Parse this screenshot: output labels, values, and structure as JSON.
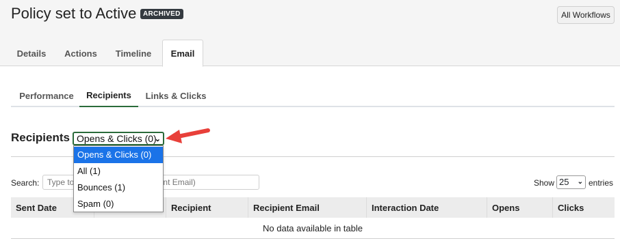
{
  "header": {
    "title": "Policy set to Active",
    "badge": "ARCHIVED",
    "all_workflows_label": "All Workflows"
  },
  "main_tabs": [
    {
      "label": "Details",
      "active": false
    },
    {
      "label": "Actions",
      "active": false
    },
    {
      "label": "Timeline",
      "active": false
    },
    {
      "label": "Email",
      "active": true
    }
  ],
  "sub_tabs": [
    {
      "label": "Performance",
      "active": false
    },
    {
      "label": "Recipients",
      "active": true
    },
    {
      "label": "Links & Clicks",
      "active": false
    }
  ],
  "recipients": {
    "heading": "Recipients",
    "filter_selected": "Opens & Clicks (0)",
    "filter_options": [
      "Opens & Clicks (0)",
      "All (1)",
      "Bounces (1)",
      "Spam (0)"
    ]
  },
  "table_controls": {
    "search_label": "Search:",
    "search_placeholder": "Type to filter (Recipient, Recipient Email)",
    "show_label": "Show",
    "show_value": "25",
    "entries_label": "entries"
  },
  "table": {
    "columns": [
      "Sent Date",
      "",
      "Recipient",
      "Recipient Email",
      "Interaction Date",
      "Opens",
      "Clicks"
    ],
    "empty_message": "No data available in table"
  },
  "colors": {
    "accent_green": "#2a6b3a",
    "annotation_arrow": "#e8403a",
    "selected_option": "#1a73e8"
  }
}
